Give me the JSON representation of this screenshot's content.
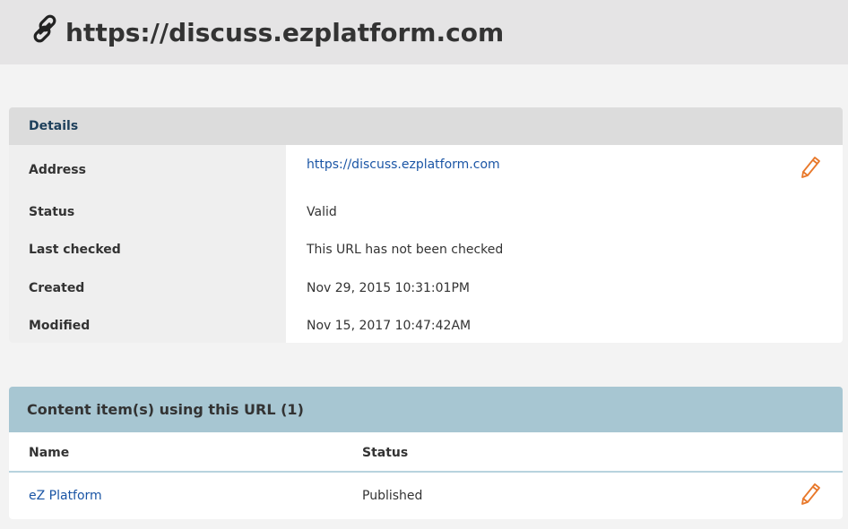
{
  "header": {
    "title": "https://discuss.ezplatform.com",
    "icon": "link-icon"
  },
  "details": {
    "heading": "Details",
    "rows": [
      {
        "label": "Address",
        "value": "https://discuss.ezplatform.com"
      },
      {
        "label": "Status",
        "value": "Valid"
      },
      {
        "label": "Last checked",
        "value": "This URL has not been checked"
      },
      {
        "label": "Created",
        "value": "Nov 29, 2015 10:31:01PM"
      },
      {
        "label": "Modified",
        "value": "Nov 15, 2017 10:47:42AM"
      }
    ]
  },
  "content_items": {
    "heading": "Content item(s) using this URL (1)",
    "columns": [
      "Name",
      "Status"
    ],
    "rows": [
      {
        "name": "eZ Platform",
        "status": "Published"
      }
    ]
  },
  "colors": {
    "accent_link": "#1a55a5",
    "edit_icon": "#e8782a",
    "details_header_bg": "#dcdcdc",
    "content_header_bg": "#a7c6d2"
  }
}
